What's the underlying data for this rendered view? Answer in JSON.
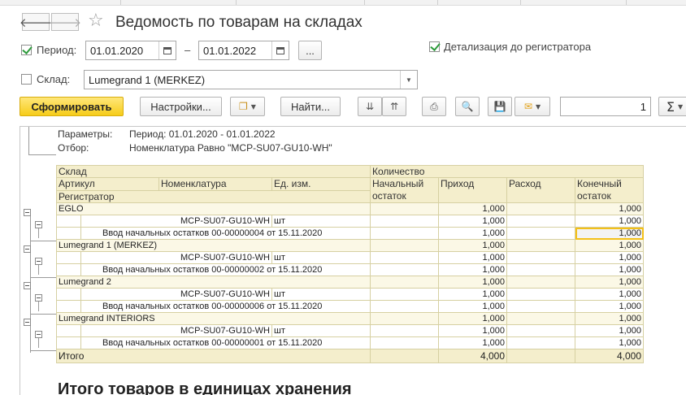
{
  "window": {
    "title": "Ведомость по товарам на складах"
  },
  "filters": {
    "period_label": "Период:",
    "period_checked": true,
    "date_from": "01.01.2020",
    "date_dash": "–",
    "date_to": "01.01.2022",
    "more_button": "...",
    "detail_label": "Детализация до регистратора",
    "detail_checked": true,
    "warehouse_label": "Склад:",
    "warehouse_checked": false,
    "warehouse_value": "Lumegrand 1 (MERKEZ)"
  },
  "toolbar": {
    "generate_label": "Сформировать",
    "settings_label": "Настройки...",
    "find_label": "Найти...",
    "page_number": "1",
    "sum_symbol": "Σ"
  },
  "report": {
    "params_label": "Параметры:",
    "params_value": "Период: 01.01.2020 - 01.01.2022",
    "filter_label": "Отбор:",
    "filter_value": "Номенклатура Равно \"MCP-SU07-GU10-WH\"",
    "headers": {
      "warehouse": "Склад",
      "quantity": "Количество",
      "article": "Артикул",
      "nomenclature": "Номенклатура",
      "unit": "Ед. изм.",
      "opening": "Начальный остаток",
      "income": "Приход",
      "expense": "Расход",
      "closing": "Конечный остаток",
      "registrar": "Регистратор"
    },
    "groups": [
      {
        "warehouse": "EGLO",
        "item": "MCP-SU07-GU10-WH",
        "unit": "шт",
        "doc": "Ввод начальных остатков 00-00000004 от 15.11.2020",
        "income": "1,000",
        "closing": "1,000"
      },
      {
        "warehouse": "Lumegrand 1 (MERKEZ)",
        "item": "MCP-SU07-GU10-WH",
        "unit": "шт",
        "doc": "Ввод начальных остатков 00-00000002 от 15.11.2020",
        "income": "1,000",
        "closing": "1,000"
      },
      {
        "warehouse": "Lumegrand 2",
        "item": "MCP-SU07-GU10-WH",
        "unit": "шт",
        "doc": "Ввод начальных остатков 00-00000006 от 15.11.2020",
        "income": "1,000",
        "closing": "1,000"
      },
      {
        "warehouse": "Lumegrand INTERIORS",
        "item": "MCP-SU07-GU10-WH",
        "unit": "шт",
        "doc": "Ввод начальных остатков 00-00000001 от 15.11.2020",
        "income": "1,000",
        "closing": "1,000"
      }
    ],
    "total_label": "Итого",
    "total_income": "4,000",
    "total_closing": "4,000",
    "section_title": "Итого товаров в единицах хранения"
  },
  "icons": [
    "back-arrow-icon",
    "forward-arrow-icon",
    "favorite-star-icon",
    "calendar-icon",
    "dropdown-arrow-icon",
    "copy-icon",
    "expand-groups-icon",
    "collapse-groups-icon",
    "print-icon",
    "preview-icon",
    "save-icon",
    "email-icon",
    "sum-icon",
    "tree-minus-icon"
  ],
  "colors": {
    "accent_yellow": "#f6cc1a",
    "header_fill": "#f4eecc",
    "selection": "#f3c019",
    "check_green": "#2e9b3c"
  }
}
